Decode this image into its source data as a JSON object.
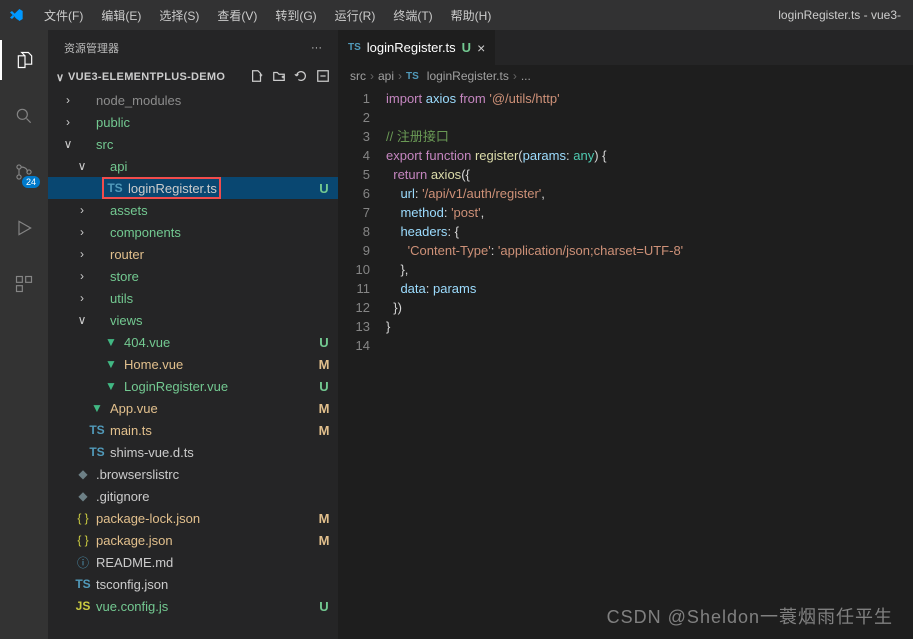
{
  "window_title": "loginRegister.ts - vue3-",
  "menu": [
    "文件(F)",
    "编辑(E)",
    "选择(S)",
    "查看(V)",
    "转到(G)",
    "运行(R)",
    "终端(T)",
    "帮助(H)"
  ],
  "activity_badge": "24",
  "sidebar_title": "资源管理器",
  "root_name": "VUE3-ELEMENTPLUS-DEMO",
  "tree": [
    {
      "indent": 1,
      "twisty": ">",
      "icon": "folder",
      "label": "node_modules",
      "cls": "muted"
    },
    {
      "indent": 1,
      "twisty": ">",
      "icon": "folder",
      "label": "public",
      "cls": "git-u"
    },
    {
      "indent": 1,
      "twisty": "v",
      "icon": "folder",
      "label": "src",
      "cls": "git-u"
    },
    {
      "indent": 2,
      "twisty": "v",
      "icon": "folder",
      "label": "api",
      "cls": "git-u"
    },
    {
      "indent": 3,
      "twisty": "",
      "icon": "ts",
      "label": "loginRegister.ts",
      "status": "U",
      "active": true,
      "highlight": true
    },
    {
      "indent": 2,
      "twisty": ">",
      "icon": "folder",
      "label": "assets",
      "cls": "git-u"
    },
    {
      "indent": 2,
      "twisty": ">",
      "icon": "folder",
      "label": "components",
      "cls": "git-u"
    },
    {
      "indent": 2,
      "twisty": ">",
      "icon": "folder",
      "label": "router",
      "cls": "git-m"
    },
    {
      "indent": 2,
      "twisty": ">",
      "icon": "folder",
      "label": "store",
      "cls": "git-u"
    },
    {
      "indent": 2,
      "twisty": ">",
      "icon": "folder",
      "label": "utils",
      "cls": "git-u"
    },
    {
      "indent": 2,
      "twisty": "v",
      "icon": "folder",
      "label": "views",
      "cls": "git-u"
    },
    {
      "indent": 3,
      "twisty": "",
      "icon": "vue",
      "label": "404.vue",
      "status": "U",
      "cls": "git-u"
    },
    {
      "indent": 3,
      "twisty": "",
      "icon": "vue",
      "label": "Home.vue",
      "status": "M",
      "cls": "git-m"
    },
    {
      "indent": 3,
      "twisty": "",
      "icon": "vue",
      "label": "LoginRegister.vue",
      "status": "U",
      "cls": "git-u"
    },
    {
      "indent": 2,
      "twisty": "",
      "icon": "vue",
      "label": "App.vue",
      "status": "M",
      "cls": "git-m"
    },
    {
      "indent": 2,
      "twisty": "",
      "icon": "ts",
      "label": "main.ts",
      "status": "M",
      "cls": "git-m"
    },
    {
      "indent": 2,
      "twisty": "",
      "icon": "ts",
      "label": "shims-vue.d.ts"
    },
    {
      "indent": 1,
      "twisty": "",
      "icon": "cfg",
      "label": ".browserslistrc"
    },
    {
      "indent": 1,
      "twisty": "",
      "icon": "cfg",
      "label": ".gitignore"
    },
    {
      "indent": 1,
      "twisty": "",
      "icon": "json",
      "label": "package-lock.json",
      "status": "M",
      "cls": "git-m"
    },
    {
      "indent": 1,
      "twisty": "",
      "icon": "json",
      "label": "package.json",
      "status": "M",
      "cls": "git-m"
    },
    {
      "indent": 1,
      "twisty": "",
      "icon": "info",
      "label": "README.md"
    },
    {
      "indent": 1,
      "twisty": "",
      "icon": "ts2",
      "label": "tsconfig.json"
    },
    {
      "indent": 1,
      "twisty": "",
      "icon": "js",
      "label": "vue.config.js",
      "status": "U",
      "cls": "git-u"
    }
  ],
  "tab": {
    "icon": "TS",
    "name": "loginRegister.ts",
    "git": "U"
  },
  "breadcrumbs": [
    "src",
    "api",
    "loginRegister.ts",
    "..."
  ],
  "code_lines": [
    [
      {
        "t": "kw",
        "v": "import"
      },
      {
        "t": "pl",
        "v": " "
      },
      {
        "t": "var",
        "v": "axios"
      },
      {
        "t": "pl",
        "v": " "
      },
      {
        "t": "kw",
        "v": "from"
      },
      {
        "t": "pl",
        "v": " "
      },
      {
        "t": "str",
        "v": "'@/utils/http'"
      }
    ],
    [],
    [
      {
        "t": "cmt",
        "v": "// 注册接口"
      }
    ],
    [
      {
        "t": "kw",
        "v": "export"
      },
      {
        "t": "pl",
        "v": " "
      },
      {
        "t": "kw",
        "v": "function"
      },
      {
        "t": "pl",
        "v": " "
      },
      {
        "t": "fn",
        "v": "register"
      },
      {
        "t": "pl",
        "v": "("
      },
      {
        "t": "var",
        "v": "params"
      },
      {
        "t": "pl",
        "v": ": "
      },
      {
        "t": "type",
        "v": "any"
      },
      {
        "t": "pl",
        "v": ") {"
      }
    ],
    [
      {
        "t": "pl",
        "v": "  "
      },
      {
        "t": "kw",
        "v": "return"
      },
      {
        "t": "pl",
        "v": " "
      },
      {
        "t": "fn",
        "v": "axios"
      },
      {
        "t": "pl",
        "v": "({"
      }
    ],
    [
      {
        "t": "pl",
        "v": "    "
      },
      {
        "t": "var",
        "v": "url"
      },
      {
        "t": "pl",
        "v": ": "
      },
      {
        "t": "str",
        "v": "'/api/v1/auth/register'"
      },
      {
        "t": "pl",
        "v": ","
      }
    ],
    [
      {
        "t": "pl",
        "v": "    "
      },
      {
        "t": "var",
        "v": "method"
      },
      {
        "t": "pl",
        "v": ": "
      },
      {
        "t": "str",
        "v": "'post'"
      },
      {
        "t": "pl",
        "v": ","
      }
    ],
    [
      {
        "t": "pl",
        "v": "    "
      },
      {
        "t": "var",
        "v": "headers"
      },
      {
        "t": "pl",
        "v": ": {"
      }
    ],
    [
      {
        "t": "pl",
        "v": "      "
      },
      {
        "t": "str",
        "v": "'Content-Type'"
      },
      {
        "t": "pl",
        "v": ": "
      },
      {
        "t": "str",
        "v": "'application/json;charset=UTF-8'"
      }
    ],
    [
      {
        "t": "pl",
        "v": "    },"
      }
    ],
    [
      {
        "t": "pl",
        "v": "    "
      },
      {
        "t": "var",
        "v": "data"
      },
      {
        "t": "pl",
        "v": ": "
      },
      {
        "t": "var",
        "v": "params"
      }
    ],
    [
      {
        "t": "pl",
        "v": "  })"
      }
    ],
    [
      {
        "t": "pl",
        "v": "}"
      }
    ],
    []
  ],
  "watermark": "CSDN @Sheldon一蓑烟雨任平生"
}
